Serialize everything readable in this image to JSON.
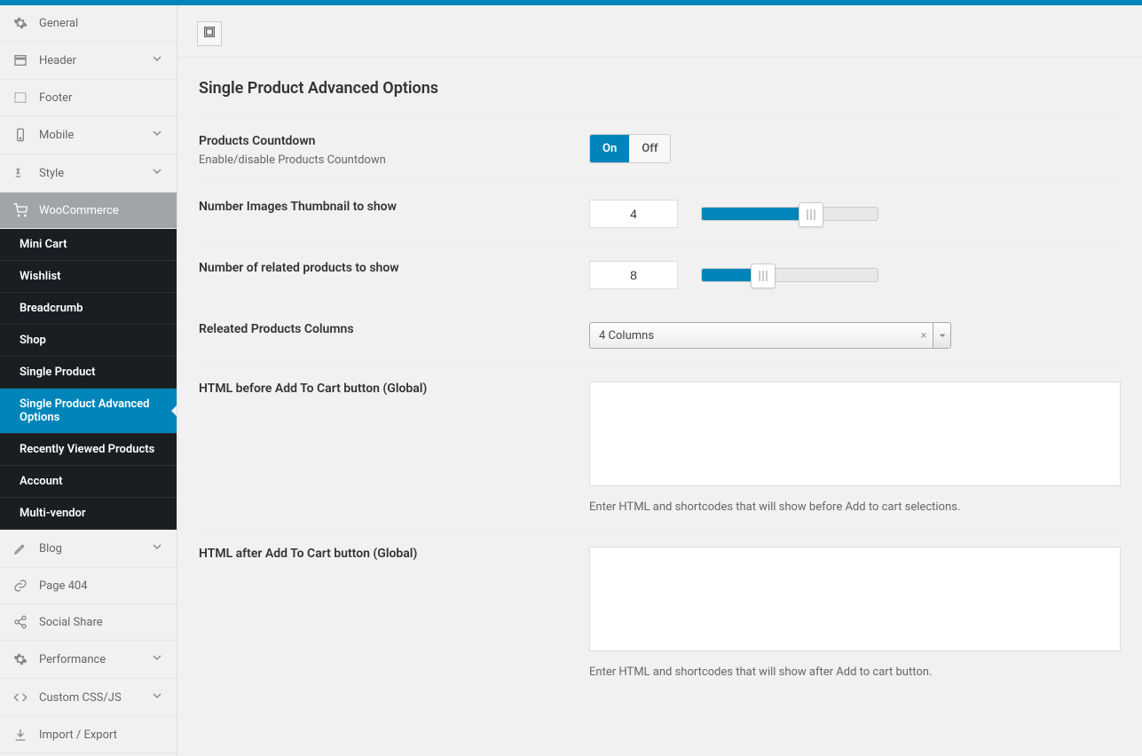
{
  "sidebar": {
    "nav": [
      {
        "id": "general",
        "label": "General",
        "chev": false
      },
      {
        "id": "header",
        "label": "Header",
        "chev": true
      },
      {
        "id": "footer",
        "label": "Footer",
        "chev": false
      },
      {
        "id": "mobile",
        "label": "Mobile",
        "chev": true
      },
      {
        "id": "style",
        "label": "Style",
        "chev": true
      }
    ],
    "woocommerce": {
      "label": "WooCommerce",
      "items": [
        {
          "id": "mini-cart",
          "label": "Mini Cart"
        },
        {
          "id": "wishlist",
          "label": "Wishlist"
        },
        {
          "id": "breadcrumb",
          "label": "Breadcrumb"
        },
        {
          "id": "shop",
          "label": "Shop"
        },
        {
          "id": "single-product",
          "label": "Single Product"
        },
        {
          "id": "single-product-adv",
          "label": "Single Product Advanced Options",
          "active": true
        },
        {
          "id": "recently-viewed",
          "label": "Recently Viewed Products"
        },
        {
          "id": "account",
          "label": "Account"
        },
        {
          "id": "multi-vendor",
          "label": "Multi-vendor"
        }
      ]
    },
    "nav2": [
      {
        "id": "blog",
        "label": "Blog",
        "chev": true
      },
      {
        "id": "page-404",
        "label": "Page 404",
        "chev": false
      },
      {
        "id": "social-share",
        "label": "Social Share",
        "chev": false
      },
      {
        "id": "performance",
        "label": "Performance",
        "chev": true
      },
      {
        "id": "custom-css-js",
        "label": "Custom CSS/JS",
        "chev": true
      },
      {
        "id": "import-export",
        "label": "Import / Export",
        "chev": false
      }
    ]
  },
  "page": {
    "title": "Single Product Advanced Options",
    "fields": {
      "countdown": {
        "label": "Products Countdown",
        "desc": "Enable/disable Products Countdown",
        "on": "On",
        "off": "Off",
        "value": "on"
      },
      "thumbnails": {
        "label": "Number Images Thumbnail to show",
        "value": "4",
        "slider_pct": 62
      },
      "related_count": {
        "label": "Number of related products to show",
        "value": "8",
        "slider_pct": 35
      },
      "related_cols": {
        "label": "Releated Products Columns",
        "value": "4 Columns"
      },
      "html_before": {
        "label": "HTML before Add To Cart button (Global)",
        "value": "",
        "help": "Enter HTML and shortcodes that will show before Add to cart selections."
      },
      "html_after": {
        "label": "HTML after Add To Cart button (Global)",
        "value": "",
        "help": "Enter HTML and shortcodes that will show after Add to cart button."
      }
    }
  }
}
